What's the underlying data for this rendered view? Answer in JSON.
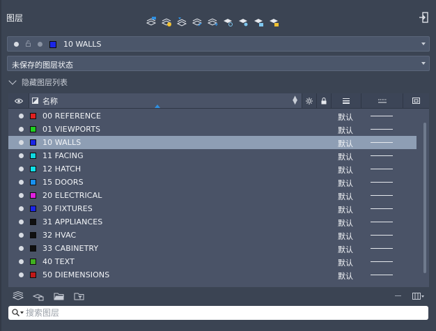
{
  "panel": {
    "title": "图层"
  },
  "current_layer": {
    "name": "10 WALLS",
    "color": "#1a25e6"
  },
  "layer_state": {
    "label": "未保存的图层状态"
  },
  "hidden_list": {
    "label": "隐藏图层列表"
  },
  "columns": {
    "name": "名称"
  },
  "layers": [
    {
      "name": "00 REFERENCE",
      "color": "#e02020",
      "lineweight": "默认"
    },
    {
      "name": "01 VIEWPORTS",
      "color": "#20d020",
      "lineweight": "默认"
    },
    {
      "name": "10 WALLS",
      "color": "#1a25e6",
      "lineweight": "默认",
      "selected": true
    },
    {
      "name": "11 FACING",
      "color": "#10d8e0",
      "lineweight": "默认"
    },
    {
      "name": "12 HATCH",
      "color": "#10e0e8",
      "lineweight": "默认"
    },
    {
      "name": "15 DOORS",
      "color": "#1890f0",
      "lineweight": "默认"
    },
    {
      "name": "20 ELECTRICAL",
      "color": "#e020e0",
      "lineweight": "默认"
    },
    {
      "name": "30 FIXTURES",
      "color": "#1a25e6",
      "lineweight": "默认"
    },
    {
      "name": "31 APPLIANCES",
      "color": "#101010",
      "lineweight": "默认"
    },
    {
      "name": "32 HVAC",
      "color": "#101010",
      "lineweight": "默认"
    },
    {
      "name": "33 CABINETRY",
      "color": "#101010",
      "lineweight": "默认"
    },
    {
      "name": "40 TEXT",
      "color": "#40b020",
      "lineweight": "默认"
    },
    {
      "name": "50 DIEMENSIONS",
      "color": "#c01818",
      "lineweight": "默认"
    }
  ],
  "search": {
    "placeholder": "搜索图层"
  }
}
